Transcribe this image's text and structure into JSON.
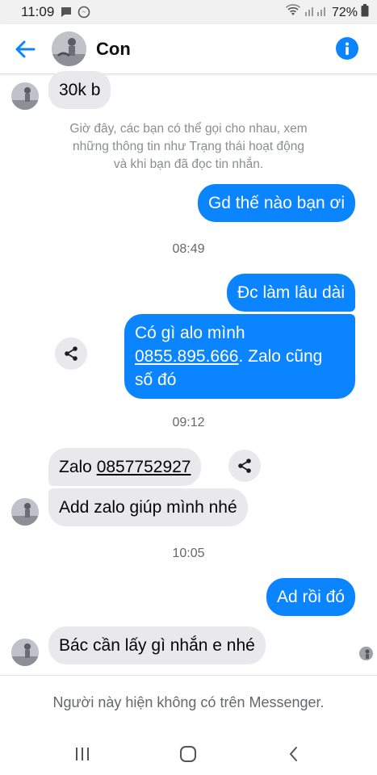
{
  "status_bar": {
    "time": "11:09",
    "battery": "72%",
    "icons": [
      "chat-notification-icon",
      "messenger-notification-icon",
      "wifi-icon",
      "signal-icon",
      "battery-icon"
    ]
  },
  "header": {
    "contact_name": "Con",
    "back_icon": "arrow-left-icon",
    "info_icon": "info-icon"
  },
  "messages": {
    "m1": "30k b",
    "notice": {
      "line1": "Giờ đây, các bạn có thể gọi cho nhau, xem",
      "line2": "những thông tin như Trạng thái hoạt động",
      "line3": "và khi bạn đã đọc tin nhắn."
    },
    "m2": "Gd thế nào bạn ơi",
    "time1": "08:49",
    "m3": "Đc làm lâu dài",
    "m4": {
      "line1": "Có gì alo mình",
      "phone": "0855.895.666",
      "line2_rest": ". Zalo cũng",
      "line3": "số đó"
    },
    "time2": "09:12",
    "m5": {
      "prefix": "Zalo ",
      "phone": "0857752927"
    },
    "m6": "Add zalo giúp mình nhé",
    "time3": "10:05",
    "m7": "Ad rồi đó",
    "m8": "Bác cần lấy gì nhắn e nhé"
  },
  "footer": {
    "note": "Người này hiện không có trên Messenger."
  },
  "nav": {
    "icons": [
      "recent-apps-icon",
      "home-icon",
      "back-nav-icon"
    ]
  },
  "colors": {
    "accent": "#0b84ff",
    "incoming_bubble": "#e9e9eb",
    "muted_text": "#8a8d91"
  }
}
